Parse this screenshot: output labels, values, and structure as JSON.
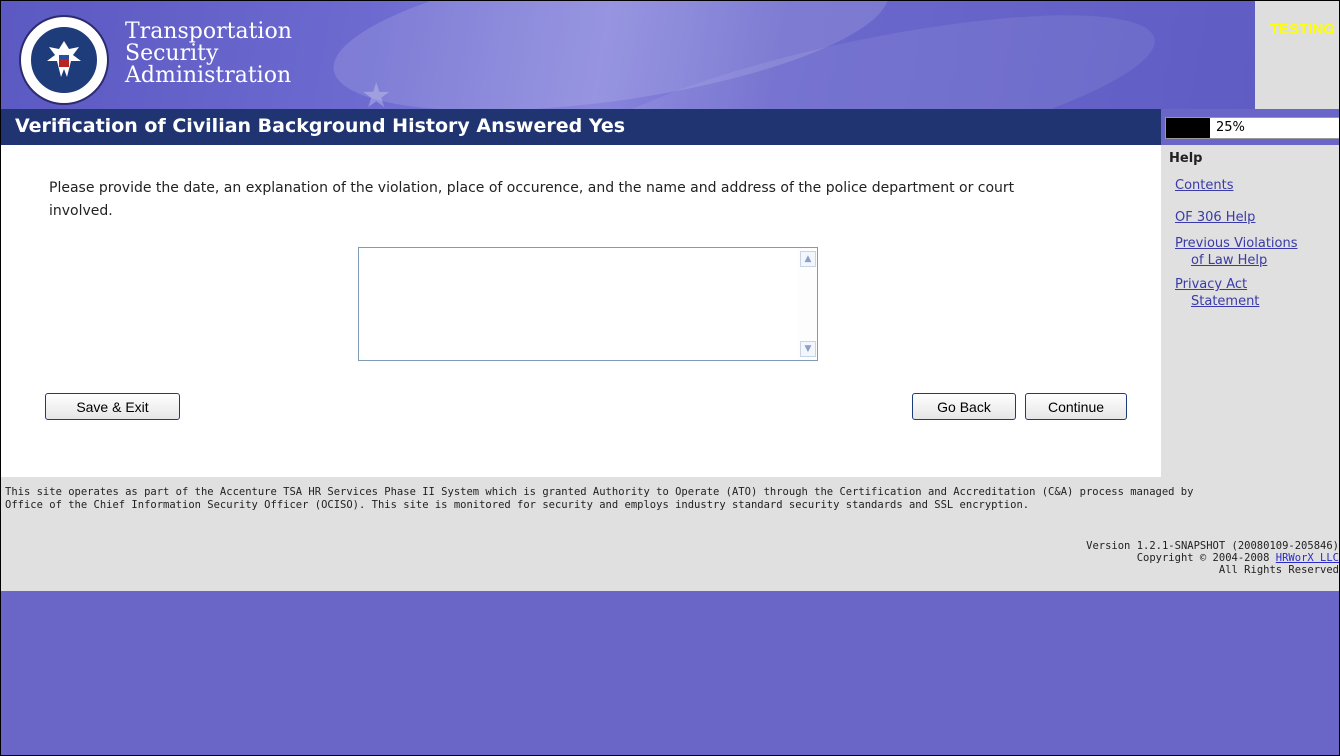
{
  "header": {
    "agency_line1": "Transportation",
    "agency_line2": "Security",
    "agency_line3": "Administration",
    "env_badge": "TESTING",
    "seal_icon": "dhs-seal-icon"
  },
  "page": {
    "title": "Verification of Civilian Background History Answered Yes",
    "instructions": "Please provide the date, an explanation of the violation, place of occurence, and the name and address of the police department or court involved.",
    "answer_value": ""
  },
  "buttons": {
    "save_exit": "Save & Exit",
    "go_back": "Go Back",
    "continue": "Continue"
  },
  "progress": {
    "percent_label": "25%",
    "fraction": 0.25
  },
  "help": {
    "heading": "Help",
    "links": [
      {
        "line1": "Contents",
        "line2": ""
      },
      {
        "line1": "OF 306 Help",
        "line2": ""
      },
      {
        "line1": "Previous Violations",
        "line2": "of Law Help"
      },
      {
        "line1": "Privacy Act",
        "line2": "Statement"
      }
    ]
  },
  "footer": {
    "disclaimer_line1": "This site operates as part of the Accenture TSA HR Services Phase II System which is granted Authority to Operate (ATO) through the Certification and Accreditation (C&A) process managed by",
    "disclaimer_line2": "Office of the Chief Information Security Officer (OCISO). This site is monitored for security and employs industry standard security standards and SSL encryption.",
    "version": "Version 1.2.1-SNAPSHOT (20080109-205846)",
    "copyright_prefix": "Copyright © 2004-2008 ",
    "copyright_link": "HRWorX LLC",
    "rights": "All Rights Reserved"
  },
  "colors": {
    "page_background": "#6a66c8",
    "title_bar": "#1f3470",
    "env_badge": "#ffff00",
    "link": "#3a3aa8"
  }
}
